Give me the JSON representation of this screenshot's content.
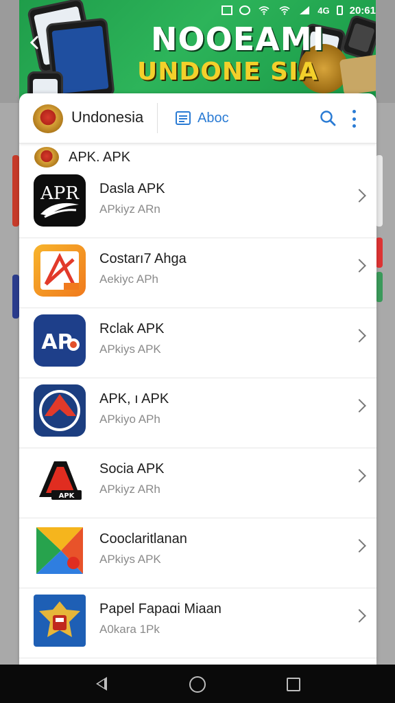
{
  "status_bar": {
    "time": "20:61",
    "network": "4G"
  },
  "banner": {
    "title_line1": "NOOEAMI",
    "title_line2": "UNDONE SIA"
  },
  "topbar": {
    "title": "Undonesia",
    "tab_label": "Aboc"
  },
  "section": {
    "label": "APK. APK"
  },
  "apps": [
    {
      "name": "Dasla APK",
      "subtitle": "APkiyz ARn",
      "icon": "apr-logo-icon"
    },
    {
      "name": "Costarı7 Ahga",
      "subtitle": "Aekiyc APh",
      "icon": "pdf-reader-icon"
    },
    {
      "name": "Rclak APK",
      "subtitle": "APkiys APK",
      "icon": "ap-logo-icon"
    },
    {
      "name": "APK, ı APK",
      "subtitle": "APkiyo APh",
      "icon": "arrow-circle-icon"
    },
    {
      "name": "Socia APK",
      "subtitle": "APkiyz ARh",
      "icon": "a-badge-icon"
    },
    {
      "name": "Cooclaritlanan",
      "subtitle": "APkiys APK",
      "icon": "play-store-icon"
    },
    {
      "name": "Papel Fapaɑi Miaan",
      "subtitle": "A0kara 1Pk",
      "icon": "garuda-emblem-icon"
    }
  ],
  "colors": {
    "accent": "#2a7bd4",
    "banner_green": "#2db45a",
    "banner_yellow": "#f3d02b"
  }
}
